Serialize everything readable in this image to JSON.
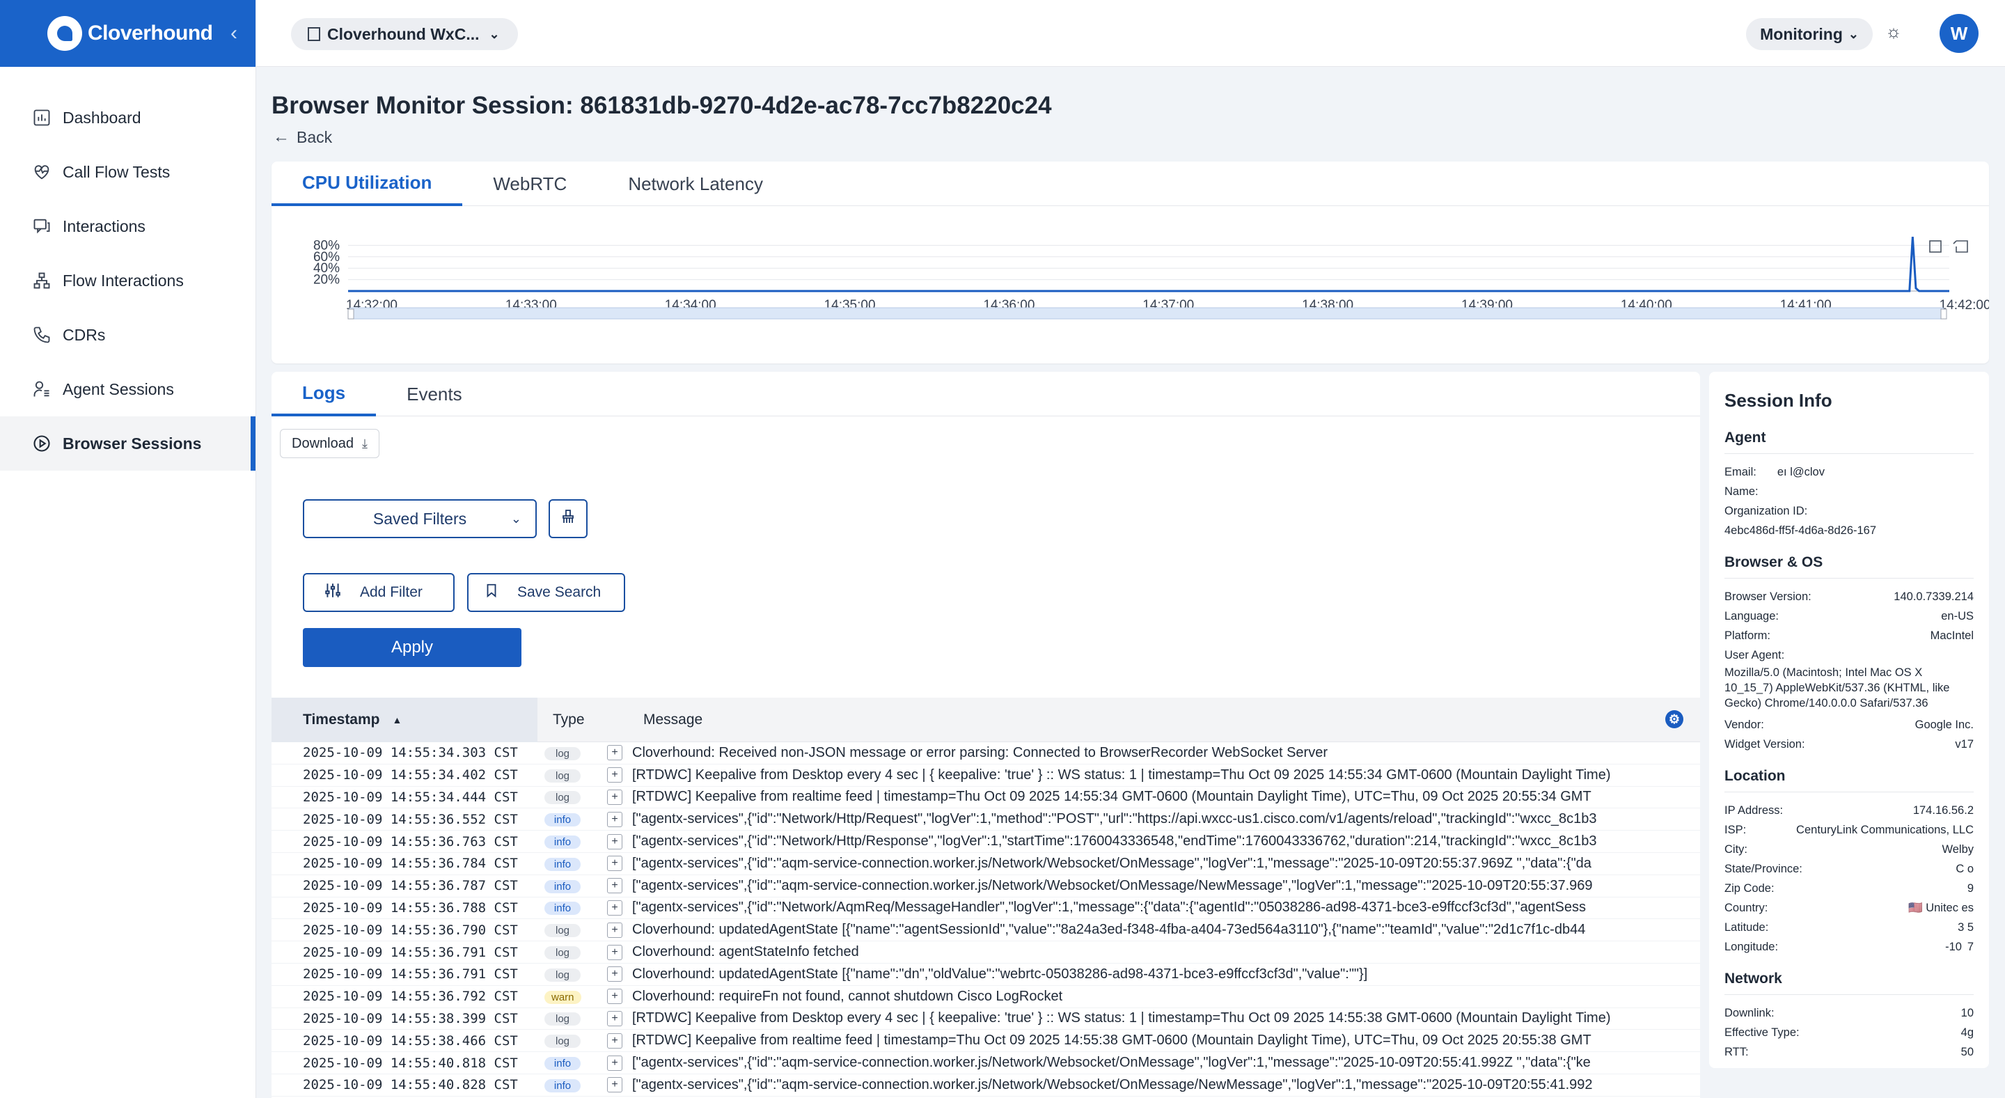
{
  "brand": {
    "name": "Cloverhound"
  },
  "sidebar": {
    "items": [
      {
        "label": "Dashboard",
        "icon": "chart-icon"
      },
      {
        "label": "Call Flow Tests",
        "icon": "heart-pulse-icon"
      },
      {
        "label": "Interactions",
        "icon": "chat-icon"
      },
      {
        "label": "Flow Interactions",
        "icon": "flow-icon"
      },
      {
        "label": "CDRs",
        "icon": "phone-icon"
      },
      {
        "label": "Agent Sessions",
        "icon": "user-list-icon"
      },
      {
        "label": "Browser Sessions",
        "icon": "play-circle-icon"
      }
    ],
    "active_index": 6
  },
  "topbar": {
    "org": "Cloverhound WxC...",
    "monitoring": "Monitoring",
    "avatar": "W"
  },
  "page": {
    "title": "Browser Monitor Session: 861831db-9270-4d2e-ac78-7cc7b8220c24",
    "back": "Back"
  },
  "chart_tabs": [
    "CPU Utilization",
    "WebRTC",
    "Network Latency"
  ],
  "chart_data": {
    "type": "line",
    "title": "",
    "x": [
      "14:32:00",
      "14:33:00",
      "14:34:00",
      "14:35:00",
      "14:36:00",
      "14:37:00",
      "14:38:00",
      "14:39:00",
      "14:40:00",
      "14:41:00",
      "14:42:00"
    ],
    "y_ticks": [
      "80%",
      "60%",
      "40%",
      "20%"
    ],
    "ylim": [
      0,
      100
    ],
    "series": [
      {
        "points": [
          [
            0,
            0
          ],
          [
            9.8,
            0
          ],
          [
            9.82,
            95
          ],
          [
            9.84,
            5
          ],
          [
            9.86,
            0
          ],
          [
            10.05,
            0
          ]
        ]
      }
    ],
    "grid": true
  },
  "logs_tabs": [
    "Logs",
    "Events"
  ],
  "controls": {
    "download": "Download",
    "saved_filters": "Saved Filters",
    "add_filter": "Add Filter",
    "save_search": "Save Search",
    "apply": "Apply"
  },
  "log_table": {
    "headers": {
      "timestamp": "Timestamp",
      "type": "Type",
      "message": "Message"
    },
    "rows": [
      {
        "ts": "2025-10-09 14:55:34.303 CST",
        "type": "log",
        "msg": "Cloverhound: Received non-JSON message or error parsing: Connected to BrowserRecorder WebSocket Server"
      },
      {
        "ts": "2025-10-09 14:55:34.402 CST",
        "type": "log",
        "msg": "[RTDWC] Keepalive from Desktop every 4 sec | { keepalive: 'true' } :: WS status: 1 | timestamp=Thu Oct 09 2025 14:55:34 GMT-0600 (Mountain Daylight Time)"
      },
      {
        "ts": "2025-10-09 14:55:34.444 CST",
        "type": "log",
        "msg": "[RTDWC] Keepalive from realtime feed | timestamp=Thu Oct 09 2025 14:55:34 GMT-0600 (Mountain Daylight Time), UTC=Thu, 09 Oct 2025 20:55:34 GMT"
      },
      {
        "ts": "2025-10-09 14:55:36.552 CST",
        "type": "info",
        "msg": "[\"agentx-services\",{\"id\":\"Network/Http/Request\",\"logVer\":1,\"method\":\"POST\",\"url\":\"https://api.wxcc-us1.cisco.com/v1/agents/reload\",\"trackingId\":\"wxcc_8c1b3"
      },
      {
        "ts": "2025-10-09 14:55:36.763 CST",
        "type": "info",
        "msg": "[\"agentx-services\",{\"id\":\"Network/Http/Response\",\"logVer\":1,\"startTime\":1760043336548,\"endTime\":1760043336762,\"duration\":214,\"trackingId\":\"wxcc_8c1b3"
      },
      {
        "ts": "2025-10-09 14:55:36.784 CST",
        "type": "info",
        "msg": "[\"agentx-services\",{\"id\":\"aqm-service-connection.worker.js/Network/Websocket/OnMessage\",\"logVer\":1,\"message\":\"2025-10-09T20:55:37.969Z \",\"data\":{\"da"
      },
      {
        "ts": "2025-10-09 14:55:36.787 CST",
        "type": "info",
        "msg": "[\"agentx-services\",{\"id\":\"aqm-service-connection.worker.js/Network/Websocket/OnMessage/NewMessage\",\"logVer\":1,\"message\":\"2025-10-09T20:55:37.969"
      },
      {
        "ts": "2025-10-09 14:55:36.788 CST",
        "type": "info",
        "msg": "[\"agentx-services\",{\"id\":\"Network/AqmReq/MessageHandler\",\"logVer\":1,\"message\":{\"data\":{\"agentId\":\"05038286-ad98-4371-bce3-e9ffccf3cf3d\",\"agentSess"
      },
      {
        "ts": "2025-10-09 14:55:36.790 CST",
        "type": "log",
        "msg": "Cloverhound: updatedAgentState [{\"name\":\"agentSessionId\",\"value\":\"8a24a3ed-f348-4fba-a404-73ed564a3110\"},{\"name\":\"teamId\",\"value\":\"2d1c7f1c-db44"
      },
      {
        "ts": "2025-10-09 14:55:36.791 CST",
        "type": "log",
        "msg": "Cloverhound: agentStateInfo fetched"
      },
      {
        "ts": "2025-10-09 14:55:36.791 CST",
        "type": "log",
        "msg": "Cloverhound: updatedAgentState [{\"name\":\"dn\",\"oldValue\":\"webrtc-05038286-ad98-4371-bce3-e9ffccf3cf3d\",\"value\":\"\"}]"
      },
      {
        "ts": "2025-10-09 14:55:36.792 CST",
        "type": "warn",
        "msg": "Cloverhound: requireFn not found, cannot shutdown Cisco LogRocket"
      },
      {
        "ts": "2025-10-09 14:55:38.399 CST",
        "type": "log",
        "msg": "[RTDWC] Keepalive from Desktop every 4 sec | { keepalive: 'true' } :: WS status: 1 | timestamp=Thu Oct 09 2025 14:55:38 GMT-0600 (Mountain Daylight Time)"
      },
      {
        "ts": "2025-10-09 14:55:38.466 CST",
        "type": "log",
        "msg": "[RTDWC] Keepalive from realtime feed | timestamp=Thu Oct 09 2025 14:55:38 GMT-0600 (Mountain Daylight Time), UTC=Thu, 09 Oct 2025 20:55:38 GMT"
      },
      {
        "ts": "2025-10-09 14:55:40.818 CST",
        "type": "info",
        "msg": "[\"agentx-services\",{\"id\":\"aqm-service-connection.worker.js/Network/Websocket/OnMessage\",\"logVer\":1,\"message\":\"2025-10-09T20:55:41.992Z \",\"data\":{\"ke"
      },
      {
        "ts": "2025-10-09 14:55:40.828 CST",
        "type": "info",
        "msg": "[\"agentx-services\",{\"id\":\"aqm-service-connection.worker.js/Network/Websocket/OnMessage/NewMessage\",\"logVer\":1,\"message\":\"2025-10-09T20:55:41.992"
      }
    ]
  },
  "session_info": {
    "title": "Session Info",
    "agent": {
      "title": "Agent",
      "email_label": "Email:",
      "email_value": "eı                    l@clov",
      "name_label": "Name:",
      "name_value": "",
      "org_label": "Organization ID:",
      "org_value": "4ebc486d-ff5f-4d6a-8d26-167"
    },
    "browser": {
      "title": "Browser & OS",
      "rows": [
        {
          "k": "Browser Version:",
          "v": "140.0.7339.214"
        },
        {
          "k": "Language:",
          "v": "en-US"
        },
        {
          "k": "Platform:",
          "v": "MacIntel"
        }
      ],
      "ua_label": "User Agent:",
      "ua_value": "Mozilla/5.0 (Macintosh; Intel Mac OS X 10_15_7) AppleWebKit/537.36 (KHTML, like Gecko) Chrome/140.0.0.0 Safari/537.36",
      "rows2": [
        {
          "k": "Vendor:",
          "v": "Google Inc."
        },
        {
          "k": "Widget Version:",
          "v": "v17"
        }
      ]
    },
    "location": {
      "title": "Location",
      "rows": [
        {
          "k": "IP Address:",
          "v": "174.16.56.2"
        },
        {
          "k": "ISP:",
          "v": "CenturyLink Communications, LLC"
        },
        {
          "k": "City:",
          "v": "Welby"
        },
        {
          "k": "State/Province:",
          "v": "C          o"
        },
        {
          "k": "Zip Code:",
          "v": "9"
        },
        {
          "k": "Country:",
          "v": "🇺🇸 Unitec       es"
        },
        {
          "k": "Latitude:",
          "v": "3       5"
        },
        {
          "k": "Longitude:",
          "v": "-10        7"
        }
      ]
    },
    "network": {
      "title": "Network",
      "rows": [
        {
          "k": "Downlink:",
          "v": "10"
        },
        {
          "k": "Effective Type:",
          "v": "4g"
        },
        {
          "k": "RTT:",
          "v": "50"
        }
      ]
    }
  }
}
